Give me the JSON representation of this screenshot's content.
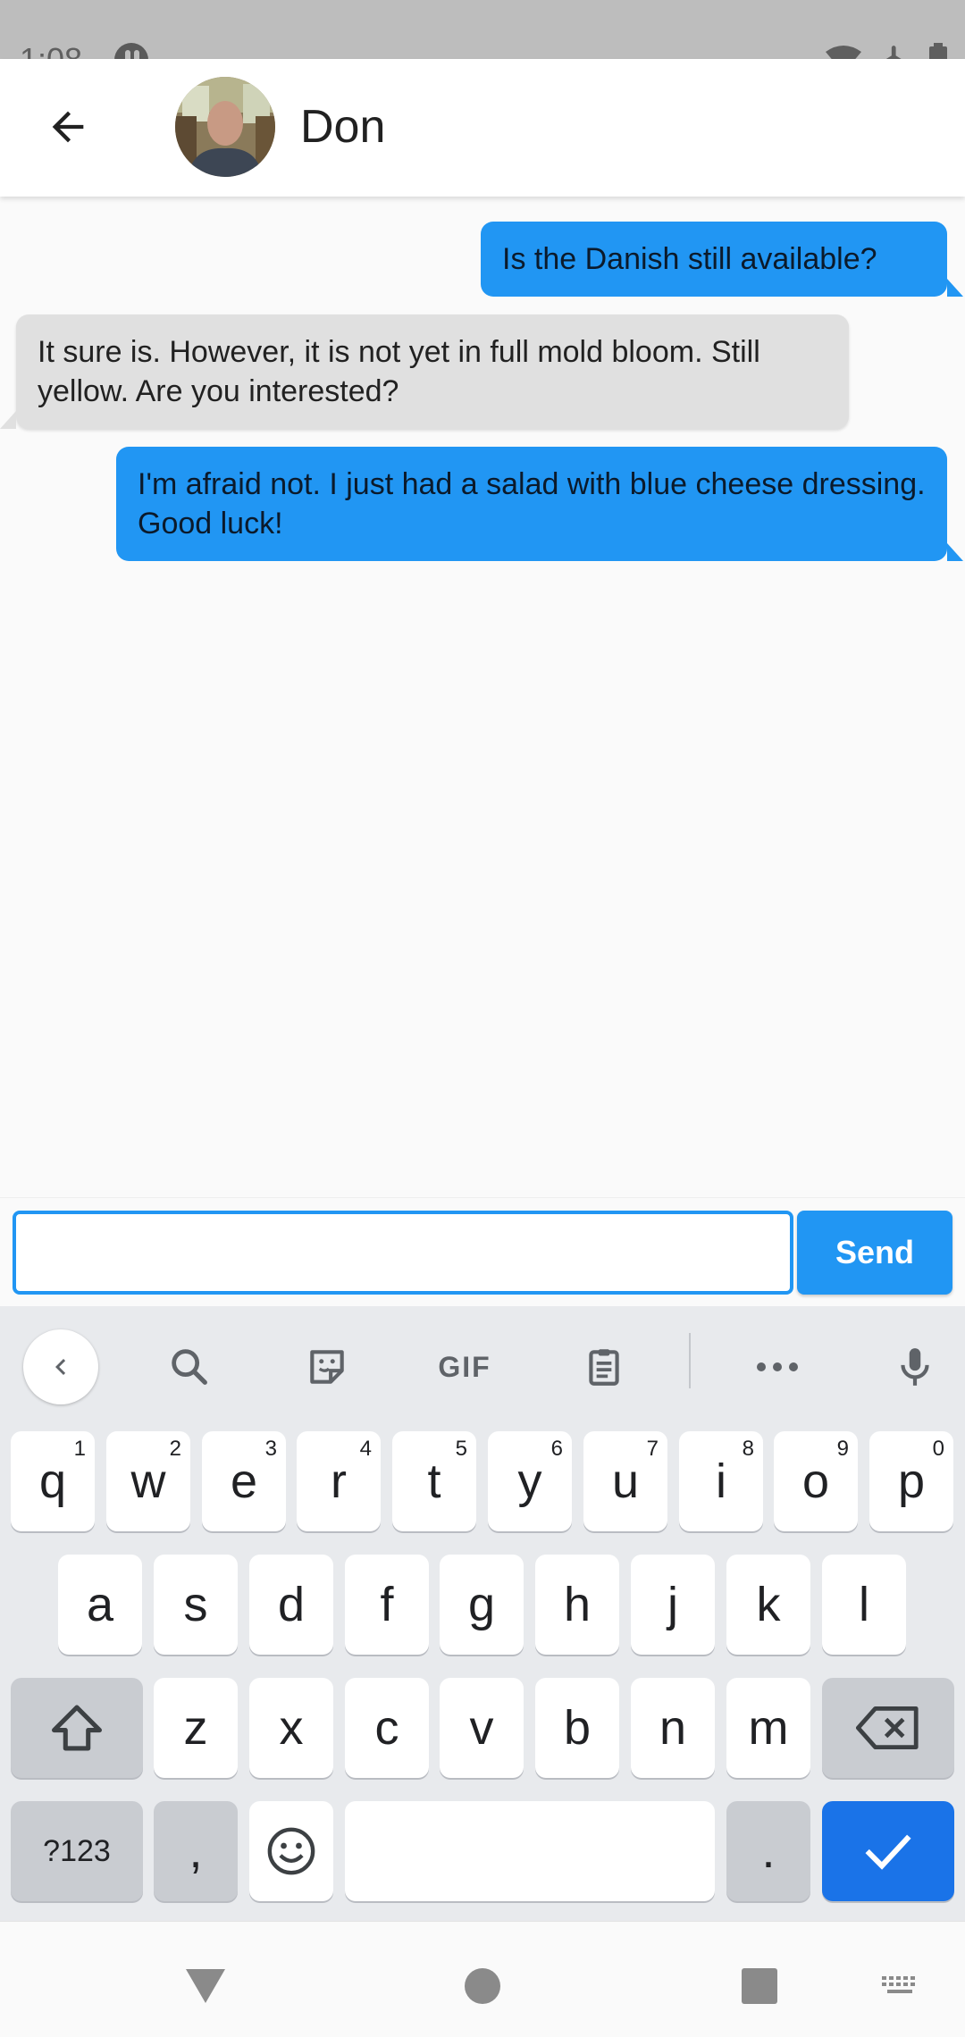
{
  "status_bar": {
    "time": "1:08"
  },
  "contact": {
    "name": "Don"
  },
  "messages": [
    {
      "direction": "outgoing",
      "text": "Is the Danish still available?"
    },
    {
      "direction": "incoming",
      "text": "It sure is. However, it is not yet in full mold bloom. Still yellow. Are you interested?"
    },
    {
      "direction": "outgoing",
      "text": "I'm afraid not. I just had a salad with blue cheese dressing. Good luck!"
    }
  ],
  "composer": {
    "input_value": "",
    "send_label": "Send"
  },
  "keyboard": {
    "toolbar": {
      "gif_label": "GIF"
    },
    "row1": [
      {
        "label": "q",
        "hint": "1"
      },
      {
        "label": "w",
        "hint": "2"
      },
      {
        "label": "e",
        "hint": "3"
      },
      {
        "label": "r",
        "hint": "4"
      },
      {
        "label": "t",
        "hint": "5"
      },
      {
        "label": "y",
        "hint": "6"
      },
      {
        "label": "u",
        "hint": "7"
      },
      {
        "label": "i",
        "hint": "8"
      },
      {
        "label": "o",
        "hint": "9"
      },
      {
        "label": "p",
        "hint": "0"
      }
    ],
    "row2": [
      "a",
      "s",
      "d",
      "f",
      "g",
      "h",
      "j",
      "k",
      "l"
    ],
    "row3": [
      "z",
      "x",
      "c",
      "v",
      "b",
      "n",
      "m"
    ],
    "symbols_label": "?123",
    "comma_label": ",",
    "period_label": "."
  },
  "colors": {
    "accent": "#2196f3",
    "incoming_bubble": "#e0e0e0",
    "keyboard_bg": "#e8eaed",
    "enter_key": "#1a73e8"
  },
  "icons": {
    "status_bar": [
      "wifi-icon",
      "airplane-mode-icon",
      "battery-icon"
    ],
    "app_bar": [
      "back-arrow-icon"
    ],
    "keyboard_toolbar": [
      "collapse-icon",
      "search-icon",
      "sticker-icon",
      "clipboard-icon",
      "more-icon",
      "microphone-icon"
    ],
    "navigation": [
      "nav-back-icon",
      "nav-home-icon",
      "nav-recents-icon",
      "keyboard-switch-icon"
    ]
  }
}
